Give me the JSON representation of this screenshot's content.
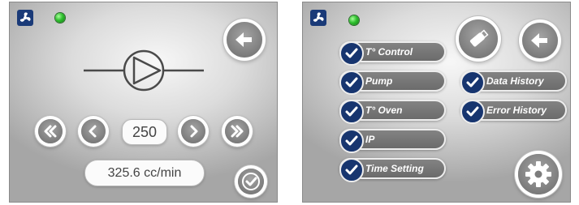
{
  "screen_left": {
    "flow_value": "250",
    "flow_rate": "325.6 cc/min",
    "icons": [
      "fan-logo-icon",
      "status-led-icon",
      "back-arrow-icon",
      "pump-symbol-icon",
      "fast-rewind-icon",
      "decrease-icon",
      "increase-icon",
      "fast-forward-icon",
      "confirm-check-icon"
    ]
  },
  "screen_right": {
    "menu_left": [
      {
        "label": "T° Control"
      },
      {
        "label": "Pump"
      },
      {
        "label": "T° Oven"
      },
      {
        "label": "IP"
      },
      {
        "label": "Time Setting"
      }
    ],
    "menu_right": [
      {
        "label": "Data History"
      },
      {
        "label": "Error History"
      }
    ],
    "icons": [
      "fan-logo-icon",
      "status-led-icon",
      "usb-drive-icon",
      "back-arrow-icon",
      "settings-gear-icon",
      "checkbox-check-icon"
    ]
  },
  "colors": {
    "check_badge": "#17356f",
    "pill_fill": "#7a7a7a",
    "led_green": "#2fbf2f",
    "logo_blue": "#1a3a78"
  }
}
